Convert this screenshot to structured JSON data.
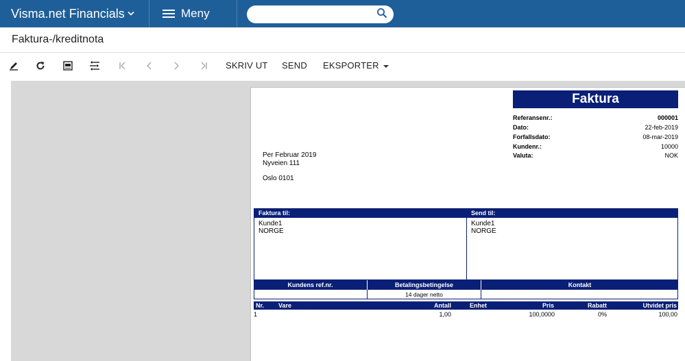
{
  "topbar": {
    "app_title": "Visma.net Financials",
    "menu_label": "Meny",
    "search_placeholder": ""
  },
  "page": {
    "title": "Faktura-/kreditnota"
  },
  "toolbar": {
    "icons": [
      "edit-icon",
      "refresh-icon",
      "pdf-icon",
      "parameters-icon",
      "first-page-icon",
      "previous-page-icon",
      "next-page-icon",
      "last-page-icon"
    ],
    "print_label": "SKRIV UT",
    "send_label": "SEND",
    "export_label": "EKSPORTER"
  },
  "report": {
    "title": "Faktura",
    "meta": [
      {
        "label": "Referansenr.:",
        "value": "000001",
        "bold": true
      },
      {
        "label": "Dato:",
        "value": "22-feb-2019"
      },
      {
        "label": "Forfallsdato:",
        "value": "08-mar-2019"
      },
      {
        "label": "Kundenr.:",
        "value": "10000"
      },
      {
        "label": "Valuta:",
        "value": "NOK"
      }
    ],
    "sender": {
      "name": "Per Februar 2019",
      "street": "Nyveien 111",
      "city": "Oslo 0101"
    },
    "bill_to": {
      "heading": "Faktura til:",
      "line1": "Kunde1",
      "line2": "NORGE"
    },
    "ship_to": {
      "heading": "Send til:",
      "line1": "Kunde1",
      "line2": "NORGE"
    },
    "ref_table": {
      "headers": [
        "Kundens ref.nr.",
        "Betalingsbetingelse",
        "Kontakt"
      ],
      "values": [
        "",
        "14 dager netto",
        ""
      ]
    },
    "items": {
      "headers": {
        "nr": "Nr.",
        "vare": "Vare",
        "antall": "Antall",
        "enhet": "Enhet",
        "pris": "Pris",
        "rabatt": "Rabatt",
        "utvidet": "Utvidet pris"
      },
      "rows": [
        {
          "nr": "1",
          "vare": "",
          "antall": "1,00",
          "enhet": "",
          "pris": "100,0000",
          "rabatt": "0%",
          "utvidet": "100,00"
        }
      ]
    }
  },
  "colors": {
    "topbar": "#1f5f99",
    "report_navy": "#0a1f76",
    "viewer_bg": "#d8d8d8"
  }
}
